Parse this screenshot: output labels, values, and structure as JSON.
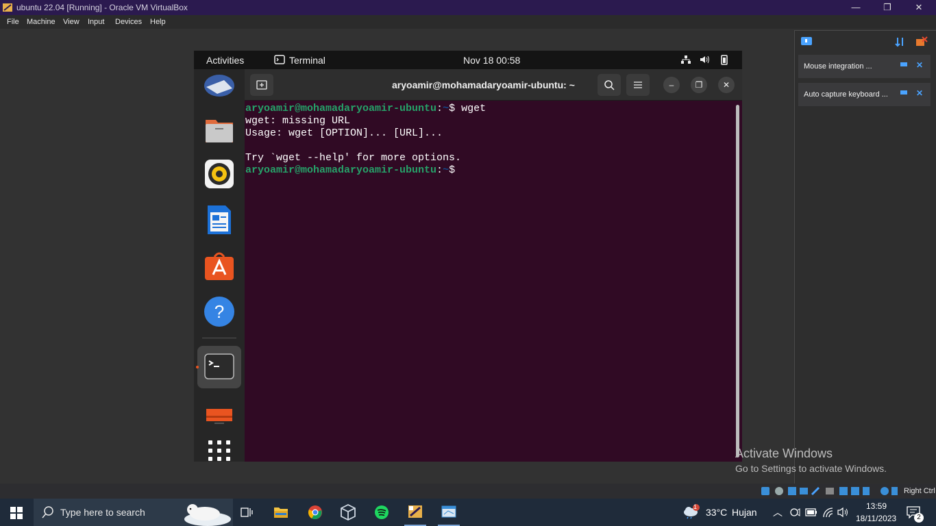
{
  "host": {
    "window_title": "ubuntu 22.04 [Running] - Oracle VM VirtualBox",
    "menu": [
      "File",
      "Machine",
      "View",
      "Input",
      "Devices",
      "Help"
    ],
    "notifications": [
      {
        "text": "Mouse integration ..."
      },
      {
        "text": "Auto capture keyboard ..."
      }
    ],
    "watermark": {
      "title": "Activate Windows",
      "subtitle": "Go to Settings to activate Windows."
    },
    "host_key_label": "Right Ctrl"
  },
  "gnome": {
    "activities": "Activities",
    "app_name": "Terminal",
    "clock": "Nov 18  00:58"
  },
  "dock": {
    "apps": [
      "thunderbird-icon",
      "files-icon",
      "rhythmbox-icon",
      "writer-icon",
      "software-icon",
      "help-icon",
      "terminal-icon",
      "trash-icon",
      "app-grid-icon"
    ]
  },
  "terminal": {
    "title": "aryoamir@mohamadaryoamir-ubuntu: ~",
    "prompt_user": "aryoamir@mohamadaryoamir-ubuntu",
    "prompt_colon": ":",
    "prompt_path": "~",
    "prompt_symbol": "$ ",
    "command": "wget",
    "output": [
      "wget: missing URL",
      "Usage: wget [OPTION]... [URL]...",
      "",
      "Try `wget --help' for more options."
    ]
  },
  "taskbar": {
    "search_placeholder": "Type here to search",
    "weather_temp": "33°C",
    "weather_desc": "Hujan",
    "weather_badge": "1",
    "time": "13:59",
    "date": "18/11/2023",
    "notification_count": "2"
  },
  "colors": {
    "terminal_bg": "#300a24",
    "prompt_user": "#26a269",
    "prompt_path": "#12488b",
    "vbox_titlebar": "#2b1a4f",
    "taskbar": "#1f2b3a"
  }
}
